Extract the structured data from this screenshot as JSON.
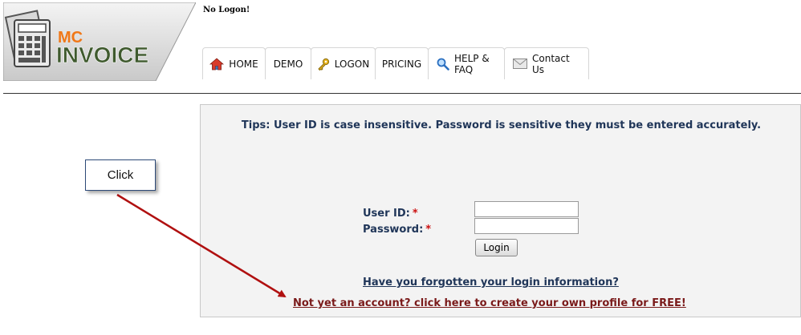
{
  "logo": {
    "brand_top": "MC",
    "brand_main": "INVOICE"
  },
  "status": "No Logon!",
  "nav": {
    "tabs": [
      {
        "label": "HOME",
        "icon": "home-icon"
      },
      {
        "label": "DEMO",
        "icon": ""
      },
      {
        "label": "LOGON",
        "icon": "key-icon"
      },
      {
        "label": "PRICING",
        "icon": ""
      },
      {
        "label": "HELP & FAQ",
        "icon": "magnifier-icon"
      },
      {
        "label": "Contact Us",
        "icon": "envelope-icon"
      }
    ]
  },
  "login": {
    "tips": "Tips: User ID is case insensitive. Password is sensitive they must be entered accurately.",
    "user_id_label": "User ID:",
    "password_label": "Password:",
    "required_mark": "*",
    "user_id_value": "",
    "password_value": "",
    "login_button": "Login",
    "forgot_link": "Have you forgotten your login information?",
    "signup_link": "Not yet an account? click here to create your own profile for FREE!"
  },
  "annotation": {
    "callout": "Click"
  },
  "colors": {
    "label_navy": "#1f3558",
    "required_red": "#cc1111",
    "signup_link": "#7a1a1a",
    "arrow_red": "#b01010",
    "logo_orange": "#f07818",
    "logo_green": "#3f5a2e"
  }
}
